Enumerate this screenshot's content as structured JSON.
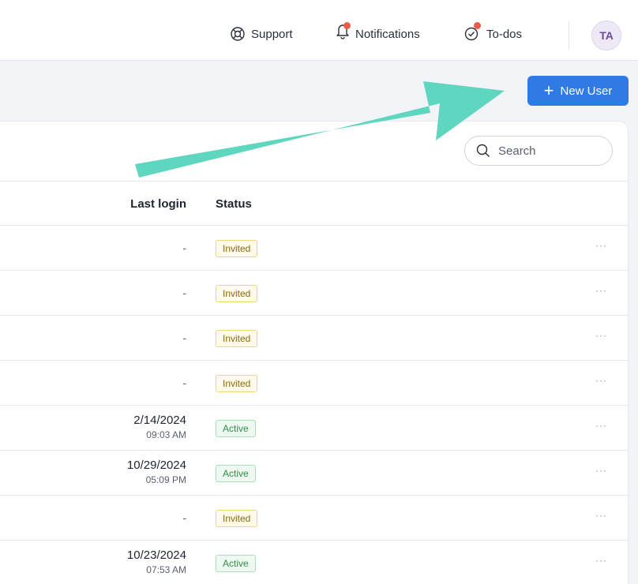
{
  "header": {
    "support_label": "Support",
    "notifications_label": "Notifications",
    "todos_label": "To-dos",
    "avatar_initials": "TA"
  },
  "actions": {
    "new_user_label": "New User"
  },
  "search": {
    "placeholder": "Search"
  },
  "table": {
    "columns": {
      "last_login": "Last login",
      "status": "Status"
    },
    "rows": [
      {
        "last_login_date": "-",
        "last_login_time": "",
        "status": "Invited",
        "menu": "···"
      },
      {
        "last_login_date": "-",
        "last_login_time": "",
        "status": "Invited",
        "menu": "···"
      },
      {
        "last_login_date": "-",
        "last_login_time": "",
        "status": "Invited",
        "menu": "···"
      },
      {
        "last_login_date": "-",
        "last_login_time": "",
        "status": "Invited",
        "menu": "···"
      },
      {
        "last_login_date": "2/14/2024",
        "last_login_time": "09:03 AM",
        "status": "Active",
        "menu": "···"
      },
      {
        "last_login_date": "10/29/2024",
        "last_login_time": "05:09 PM",
        "status": "Active",
        "menu": "···"
      },
      {
        "last_login_date": "-",
        "last_login_time": "",
        "status": "Invited",
        "menu": "···"
      },
      {
        "last_login_date": "10/23/2024",
        "last_login_time": "07:53 AM",
        "status": "Active",
        "menu": "···"
      }
    ]
  },
  "colors": {
    "primary": "#2f7ae5",
    "annotation_arrow": "#5fd6c0",
    "notification_dot": "#ef5b4a"
  },
  "icons": {
    "support": "lifebuoy-icon",
    "notifications": "bell-icon",
    "todos": "check-circle-icon",
    "search": "search-icon",
    "new_user": "plus-icon"
  }
}
